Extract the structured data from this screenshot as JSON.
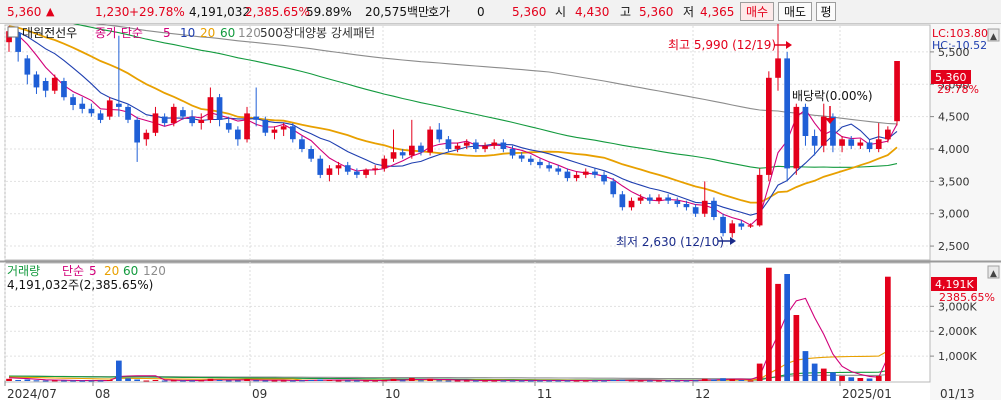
{
  "topbar": {
    "price": "5,360",
    "change": "1,230",
    "change_pct": "+29.78%",
    "volume": "4,191,032",
    "volume_pct": "2,385.65%",
    "turnover_pct": "59.89%",
    "amount": "20,575백만",
    "quote_label": "호가",
    "quote_value": "0",
    "quote_price": "5,360",
    "open_label": "시",
    "open_value": "4,430",
    "high_label": "고",
    "high_value": "5,360",
    "low_label": "저",
    "low_value": "4,365",
    "buy_button": "매수",
    "sell_button": "매도",
    "eval_button": "평"
  },
  "price_panel": {
    "stock_name": "대원전선우",
    "ma_label": "종가 단순",
    "ma_periods": [
      "5",
      "10",
      "20",
      "60",
      "120"
    ],
    "ma_colors": [
      "#d1007a",
      "#1f3fb0",
      "#e8a000",
      "#139a3e",
      "#8c8c8c"
    ],
    "pattern_label": "500장대양봉 강세패턴",
    "max_annotation": "최고 5,990 (12/19)",
    "min_annotation": "최저 2,630 (12/10)",
    "ex_rights_annotation": "배당락(0.00%)",
    "lc": "LC:103.80",
    "hc": "HC:-10.52",
    "current_price_tag": "5,360",
    "current_pct_tag": "29.78%",
    "y_ticks": [
      "5,500",
      "5,000",
      "4,500",
      "4,000",
      "3,500",
      "3,000",
      "2,500"
    ]
  },
  "volume_panel": {
    "title": "거래량",
    "ma_label": "단순",
    "ma_periods": [
      "5",
      "20",
      "60",
      "120"
    ],
    "ma_colors": [
      "#d1007a",
      "#e8a000",
      "#139a3e",
      "#8c8c8c"
    ],
    "current_volume": "4,191,032주(2,385.65%)",
    "volume_tag": "4,191K",
    "volume_pct_tag": "2385.65%",
    "y_ticks": [
      "3,000K",
      "2,000K",
      "1,000K"
    ]
  },
  "x_axis": {
    "labels": [
      "2024/07",
      "08",
      "09",
      "10",
      "11",
      "12",
      "2025/01"
    ],
    "right_label": "01/13"
  },
  "chart_data": {
    "type": "candlestick",
    "title": "대원전선우",
    "price_unit": "KRW",
    "candles": [
      [
        5650,
        5900,
        5500,
        5820
      ],
      [
        5800,
        5850,
        5350,
        5500
      ],
      [
        5400,
        5450,
        5000,
        5150
      ],
      [
        5150,
        5200,
        4850,
        4950
      ],
      [
        5050,
        5100,
        4800,
        4900
      ],
      [
        4900,
        5150,
        4850,
        5100
      ],
      [
        5050,
        5100,
        4750,
        4800
      ],
      [
        4800,
        4850,
        4600,
        4680
      ],
      [
        4700,
        4800,
        4550,
        4620
      ],
      [
        4620,
        4700,
        4500,
        4550
      ],
      [
        4550,
        4600,
        4400,
        4450
      ],
      [
        4500,
        4800,
        4450,
        4750
      ],
      [
        4700,
        5750,
        4500,
        4650
      ],
      [
        4650,
        4700,
        4400,
        4450
      ],
      [
        4450,
        4500,
        3800,
        4100
      ],
      [
        4150,
        4300,
        4050,
        4250
      ],
      [
        4250,
        4650,
        4200,
        4550
      ],
      [
        4500,
        4550,
        4350,
        4400
      ],
      [
        4400,
        4700,
        4350,
        4650
      ],
      [
        4600,
        4650,
        4450,
        4500
      ],
      [
        4500,
        4600,
        4350,
        4400
      ],
      [
        4400,
        4550,
        4300,
        4450
      ],
      [
        4450,
        4950,
        4400,
        4800
      ],
      [
        4800,
        4850,
        4350,
        4450
      ],
      [
        4400,
        4500,
        4250,
        4300
      ],
      [
        4300,
        4350,
        4050,
        4150
      ],
      [
        4150,
        4650,
        4100,
        4550
      ],
      [
        4500,
        4950,
        4350,
        4450
      ],
      [
        4450,
        4500,
        4200,
        4250
      ],
      [
        4250,
        4350,
        4150,
        4300
      ],
      [
        4300,
        4400,
        4200,
        4350
      ],
      [
        4350,
        4400,
        4100,
        4150
      ],
      [
        4150,
        4200,
        3950,
        4000
      ],
      [
        4000,
        4050,
        3800,
        3850
      ],
      [
        3850,
        3900,
        3550,
        3600
      ],
      [
        3600,
        3750,
        3500,
        3700
      ],
      [
        3700,
        3800,
        3600,
        3750
      ],
      [
        3750,
        3800,
        3600,
        3650
      ],
      [
        3650,
        3700,
        3550,
        3600
      ],
      [
        3600,
        3700,
        3550,
        3680
      ],
      [
        3680,
        3750,
        3600,
        3700
      ],
      [
        3700,
        3900,
        3650,
        3850
      ],
      [
        3850,
        4300,
        3800,
        3950
      ],
      [
        3950,
        4000,
        3850,
        3900
      ],
      [
        3900,
        4450,
        3850,
        4050
      ],
      [
        4050,
        4100,
        3900,
        3950
      ],
      [
        3950,
        4350,
        3900,
        4300
      ],
      [
        4300,
        4400,
        4100,
        4150
      ],
      [
        4150,
        4200,
        3950,
        4000
      ],
      [
        4000,
        4100,
        3950,
        4050
      ],
      [
        4050,
        4150,
        4000,
        4100
      ],
      [
        4100,
        4150,
        3950,
        4000
      ],
      [
        4000,
        4100,
        3950,
        4050
      ],
      [
        4050,
        4150,
        4000,
        4100
      ],
      [
        4100,
        4150,
        3950,
        4000
      ],
      [
        4000,
        4050,
        3850,
        3900
      ],
      [
        3900,
        3950,
        3800,
        3850
      ],
      [
        3850,
        3900,
        3750,
        3800
      ],
      [
        3800,
        3850,
        3700,
        3750
      ],
      [
        3750,
        3800,
        3650,
        3700
      ],
      [
        3700,
        3750,
        3600,
        3650
      ],
      [
        3650,
        3700,
        3500,
        3550
      ],
      [
        3550,
        3650,
        3500,
        3600
      ],
      [
        3600,
        3700,
        3550,
        3650
      ],
      [
        3650,
        3700,
        3550,
        3600
      ],
      [
        3600,
        3650,
        3450,
        3500
      ],
      [
        3500,
        3550,
        3250,
        3300
      ],
      [
        3300,
        3350,
        3050,
        3100
      ],
      [
        3100,
        3250,
        3050,
        3200
      ],
      [
        3200,
        3300,
        3150,
        3250
      ],
      [
        3250,
        3300,
        3150,
        3200
      ],
      [
        3200,
        3300,
        3150,
        3250
      ],
      [
        3250,
        3300,
        3150,
        3200
      ],
      [
        3200,
        3250,
        3100,
        3150
      ],
      [
        3150,
        3200,
        3050,
        3100
      ],
      [
        3100,
        3150,
        2950,
        3000
      ],
      [
        3000,
        3500,
        2950,
        3200
      ],
      [
        3200,
        3250,
        2900,
        2950
      ],
      [
        2950,
        3000,
        2650,
        2700
      ],
      [
        2700,
        2900,
        2630,
        2850
      ],
      [
        2850,
        2900,
        2750,
        2800
      ],
      [
        2800,
        2850,
        2780,
        2820
      ],
      [
        2820,
        3700,
        2800,
        3600
      ],
      [
        3600,
        5200,
        3500,
        5100
      ],
      [
        5100,
        5990,
        4900,
        5400
      ],
      [
        5400,
        5500,
        3500,
        3700
      ],
      [
        3700,
        4700,
        3600,
        4650
      ],
      [
        4650,
        4700,
        4050,
        4200
      ],
      [
        4200,
        4300,
        3900,
        4050
      ],
      [
        4050,
        4700,
        3950,
        4500
      ],
      [
        4500,
        4550,
        3950,
        4050
      ],
      [
        4050,
        4200,
        3950,
        4150
      ],
      [
        4150,
        4200,
        4000,
        4050
      ],
      [
        4050,
        4150,
        4000,
        4100
      ],
      [
        4100,
        4150,
        3950,
        4000
      ],
      [
        4000,
        4400,
        3950,
        4150
      ],
      [
        4150,
        4350,
        4100,
        4300
      ],
      [
        4430,
        5360,
        4365,
        5360
      ]
    ],
    "volumes_k": [
      90,
      40,
      60,
      30,
      20,
      25,
      20,
      20,
      15,
      15,
      20,
      40,
      820,
      110,
      60,
      20,
      40,
      20,
      30,
      20,
      20,
      30,
      90,
      40,
      20,
      20,
      80,
      30,
      20,
      20,
      20,
      20,
      30,
      40,
      60,
      40,
      20,
      20,
      20,
      20,
      20,
      30,
      90,
      30,
      120,
      30,
      90,
      30,
      20,
      20,
      20,
      20,
      20,
      20,
      20,
      20,
      20,
      20,
      20,
      20,
      20,
      20,
      20,
      20,
      20,
      20,
      40,
      50,
      30,
      20,
      20,
      20,
      20,
      20,
      20,
      30,
      90,
      60,
      110,
      80,
      40,
      20,
      700,
      4550,
      3900,
      4300,
      2650,
      1200,
      700,
      500,
      350,
      200,
      150,
      120,
      100,
      200,
      4191
    ],
    "price_axis_range": [
      2300,
      5900
    ],
    "volume_axis_range": [
      0,
      4700
    ]
  }
}
